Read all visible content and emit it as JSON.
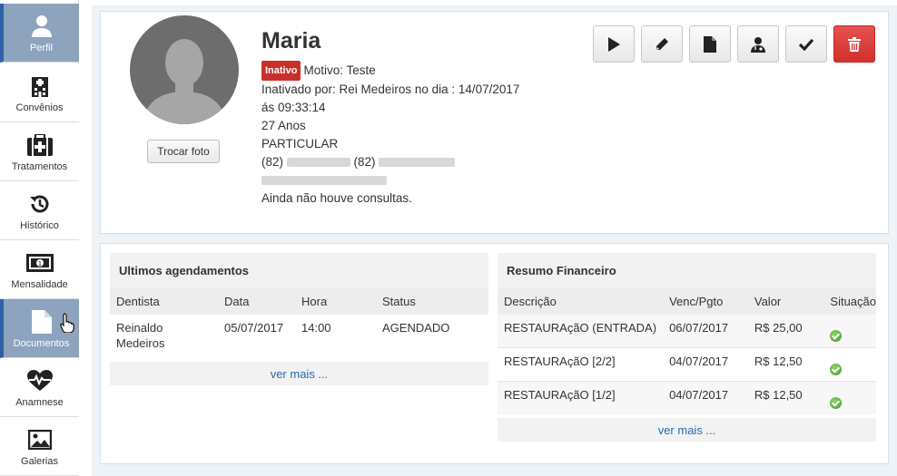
{
  "sidebar": {
    "items": [
      {
        "label": "Perfil",
        "icon": "user-icon"
      },
      {
        "label": "Convênios",
        "icon": "hospital-icon"
      },
      {
        "label": "Tratamentos",
        "icon": "medkit-icon"
      },
      {
        "label": "Histórico",
        "icon": "history-icon"
      },
      {
        "label": "Mensalidade",
        "icon": "money-icon"
      },
      {
        "label": "Documentos",
        "icon": "document-icon"
      },
      {
        "label": "Anamnese",
        "icon": "heartbeat-icon"
      },
      {
        "label": "Galerias",
        "icon": "image-icon"
      }
    ]
  },
  "profile": {
    "name": "Maria",
    "status_badge": "Inativo",
    "motivo": "Motivo: Teste",
    "inativado_por": "Inativado por: Rei Medeiros no dia : 14/07/2017",
    "inativado_hora": "ás 09:33:14",
    "idade": "27 Anos",
    "convenio": "PARTICULAR",
    "phone1_prefix": "(82)",
    "phone2_prefix": "(82)",
    "consultas": "Ainda não houve consultas.",
    "change_photo_label": "Trocar foto"
  },
  "actions": [
    {
      "name": "play-button",
      "icon": "play-icon"
    },
    {
      "name": "edit-button",
      "icon": "pencil-icon"
    },
    {
      "name": "file-button",
      "icon": "file-icon"
    },
    {
      "name": "doctor-button",
      "icon": "doctor-icon"
    },
    {
      "name": "check-button",
      "icon": "check-icon"
    },
    {
      "name": "delete-button",
      "icon": "trash-icon"
    }
  ],
  "agendamentos": {
    "title": "Ultimos agendamentos",
    "columns": [
      "Dentista",
      "Data",
      "Hora",
      "Status"
    ],
    "rows": [
      {
        "dentista": "Reinaldo Medeiros",
        "data": "05/07/2017",
        "hora": "14:00",
        "status": "AGENDADO"
      }
    ],
    "more_label": "ver mais ..."
  },
  "financeiro": {
    "title": "Resumo Financeiro",
    "columns": [
      "Descrição",
      "Venc/Pgto",
      "Valor",
      "Situação"
    ],
    "rows": [
      {
        "descricao": "RESTAURAçãO (ENTRADA)",
        "venc": "06/07/2017",
        "valor": "R$ 25,00",
        "situacao": "ok"
      },
      {
        "descricao": "RESTAURAçãO [2/2]",
        "venc": "04/07/2017",
        "valor": "R$ 12,50",
        "situacao": "ok"
      },
      {
        "descricao": "RESTAURAçãO [1/2]",
        "venc": "04/07/2017",
        "valor": "R$ 12,50",
        "situacao": "ok"
      }
    ],
    "more_label": "ver mais ..."
  },
  "colors": {
    "active_sidebar": "#8ea3bd",
    "danger": "#d1302b",
    "link": "#2a6ab0"
  }
}
